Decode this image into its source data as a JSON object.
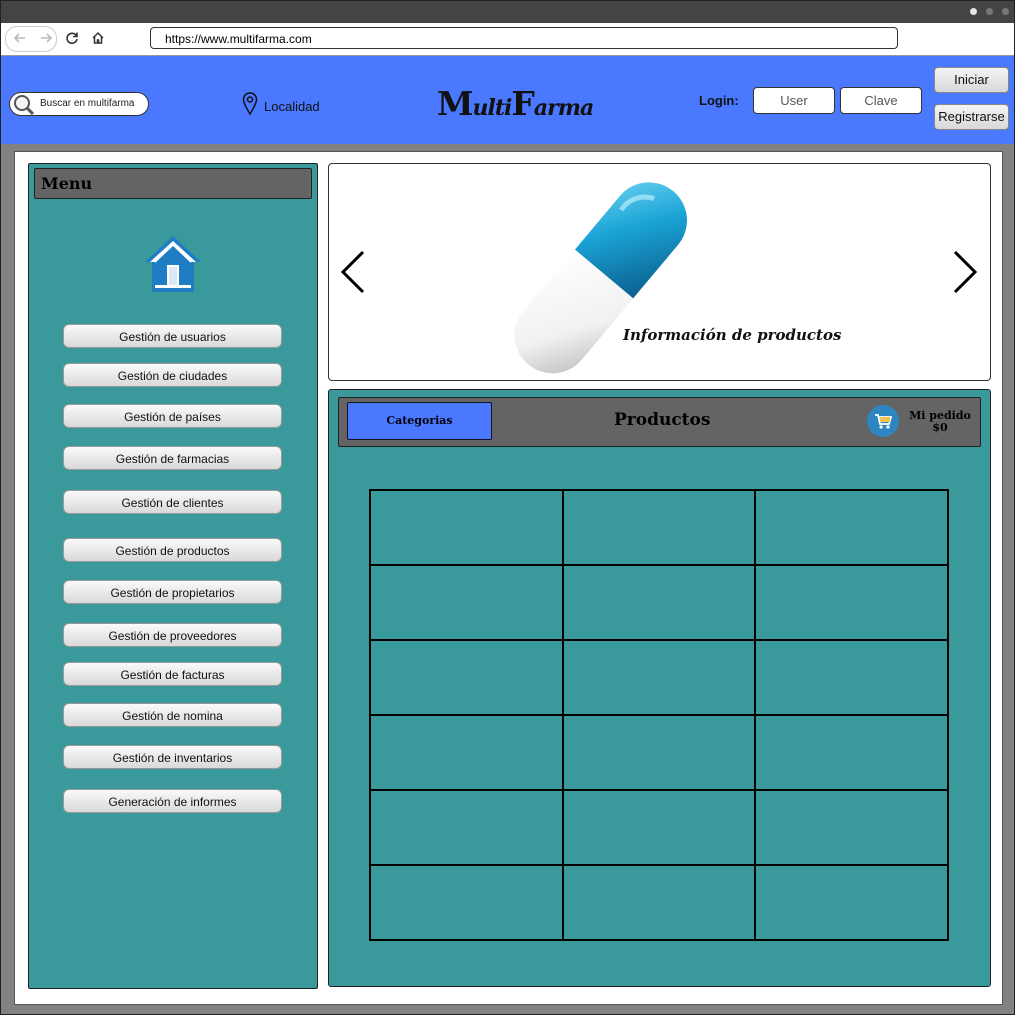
{
  "browser": {
    "url": "https://www.multifarma.com",
    "back_icon": "arrow-left-icon",
    "forward_icon": "arrow-right-icon",
    "reload_icon": "reload-icon",
    "home_icon": "home-icon"
  },
  "header": {
    "search_placeholder": "Buscar en multifarma",
    "location_label": "Localidad",
    "logo": {
      "big1": "M",
      "small1": "ulti",
      "big2": "F",
      "small2": "arma"
    },
    "login_label": "Login:",
    "user_placeholder": "User",
    "password_placeholder": "Clave",
    "login_button": "Iniciar",
    "register_button": "Registrarse",
    "accent_color": "#4a78ff"
  },
  "menu": {
    "title": "Menu",
    "home_icon": "home-icon",
    "items": [
      "Gestión de usuarios",
      "Gestión de ciudades",
      "Gestión de países",
      "Gestión de farmacias",
      "Gestión de clientes",
      "Gestión de productos",
      "Gestión de propietarios",
      "Gestión de proveedores",
      "Gestión de facturas",
      "Gestión de nomina",
      "Gestión de inventarios",
      "Generación de informes"
    ],
    "panel_color": "#3a9a9b"
  },
  "banner": {
    "caption": "Información de productos",
    "prev_icon": "chevron-left-icon",
    "next_icon": "chevron-right-icon",
    "image_icon": "capsule-pill-icon"
  },
  "products": {
    "categories_button": "Categorias",
    "title": "Productos",
    "cart_icon": "shopping-cart-icon",
    "order_label": "Mi pedido",
    "order_total": "$0",
    "grid_rows": 6,
    "grid_cols": 3
  }
}
